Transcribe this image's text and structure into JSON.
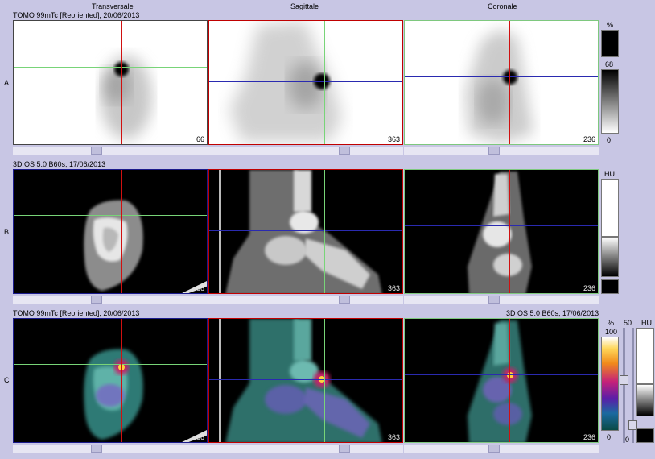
{
  "columns": {
    "transversal": "Transversale",
    "sagittal": "Sagittale",
    "coronal": "Coronale"
  },
  "rows": {
    "a": {
      "letter": "A",
      "header": "TOMO 99mTc [Reoriented], 20/06/2013"
    },
    "b": {
      "letter": "B",
      "header": "3D OS 5.0 B60s, 17/06/2013"
    },
    "c": {
      "letter": "C",
      "header_left": "TOMO 99mTc [Reoriented], 20/06/2013",
      "header_right": "3D OS 5.0 B60s, 17/06/2013"
    }
  },
  "slices": {
    "transversal": "66",
    "sagittal": "363",
    "coronal": "236"
  },
  "colorbars": {
    "a": {
      "unit": "%",
      "top": "68",
      "bottom": "0"
    },
    "b": {
      "unit": "HU"
    },
    "c": {
      "unit_pct": "%",
      "top": "100",
      "bottom": "0",
      "slider_label": "50",
      "unit_hu": "HU",
      "bottom_hu": "0"
    }
  }
}
